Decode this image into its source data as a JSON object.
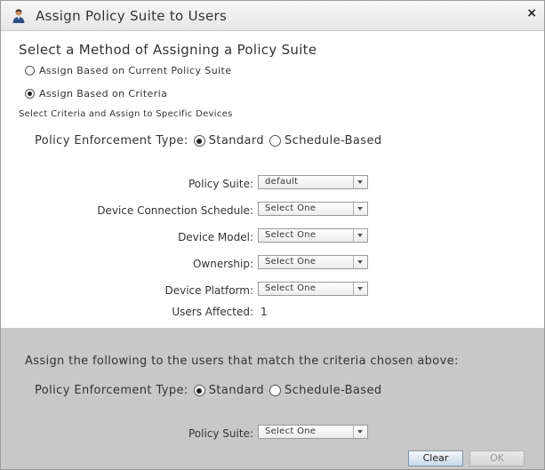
{
  "dialog": {
    "title": "Assign Policy Suite to Users",
    "close_label": "×"
  },
  "method": {
    "heading": "Select a Method of Assigning a Policy Suite",
    "option_current": "Assign Based on Current Policy Suite",
    "option_criteria": "Assign Based on Criteria",
    "selected": "criteria",
    "criteria_subtext": "Select Criteria and Assign to Specific Devices"
  },
  "criteria": {
    "enforcement_label": "Policy Enforcement Type:",
    "enforcement_standard": "Standard",
    "enforcement_schedule": "Schedule-Based",
    "enforcement_selected": "Standard",
    "fields": {
      "policy_suite": {
        "label": "Policy Suite:",
        "value": "default"
      },
      "connection_schedule": {
        "label": "Device Connection Schedule:",
        "value": "Select One"
      },
      "device_model": {
        "label": "Device Model:",
        "value": "Select One"
      },
      "ownership": {
        "label": "Ownership:",
        "value": "Select One"
      },
      "device_platform": {
        "label": "Device Platform:",
        "value": "Select One"
      }
    },
    "users_affected_label": "Users Affected:",
    "users_affected_value": "1"
  },
  "assign": {
    "heading": "Assign the following to the users that match the criteria chosen above:",
    "enforcement_label": "Policy Enforcement Type:",
    "enforcement_standard": "Standard",
    "enforcement_schedule": "Schedule-Based",
    "enforcement_selected": "Standard",
    "policy_suite_label": "Policy Suite:",
    "policy_suite_value": "Select One"
  },
  "buttons": {
    "clear": "Clear",
    "ok": "OK"
  },
  "colors": {
    "gray_section": "#c8c8c8",
    "title_bar": "#ececec"
  },
  "icons": {
    "title": "user-icon",
    "close": "close-icon"
  }
}
